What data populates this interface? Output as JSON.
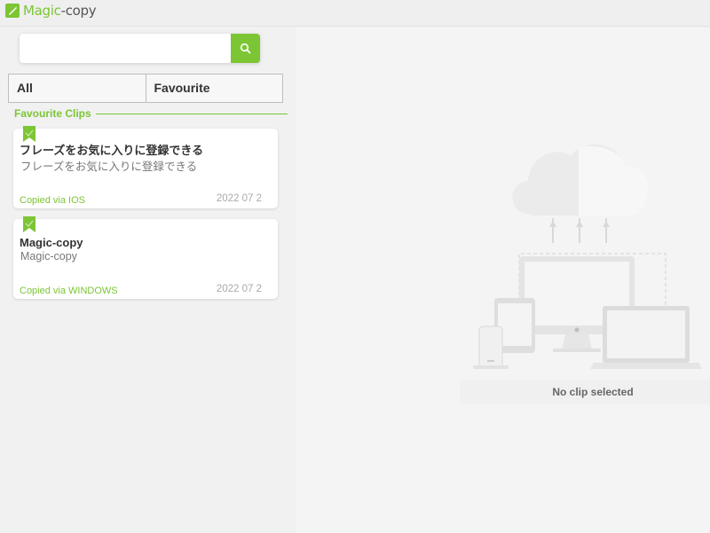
{
  "app": {
    "logo_magic": "Magic",
    "logo_copy": "-copy"
  },
  "search": {
    "placeholder": "",
    "value": ""
  },
  "tabs": [
    {
      "label": "All"
    },
    {
      "label": "Favourite"
    }
  ],
  "section": {
    "title": "Favourite Clips"
  },
  "clips": [
    {
      "title": "フレーズをお気に入りに登録できる",
      "preview": "フレーズをお気に入りに登録できる",
      "source": "Copied via IOS",
      "date": "2022 07 2"
    },
    {
      "title": "Magic-copy",
      "preview": "Magic-copy",
      "source": "Copied via WINDOWS",
      "date": "2022 07 2"
    }
  ],
  "detail": {
    "empty_text": "No clip selected"
  },
  "colors": {
    "accent": "#7cc534",
    "background": "#f1f1f1"
  }
}
